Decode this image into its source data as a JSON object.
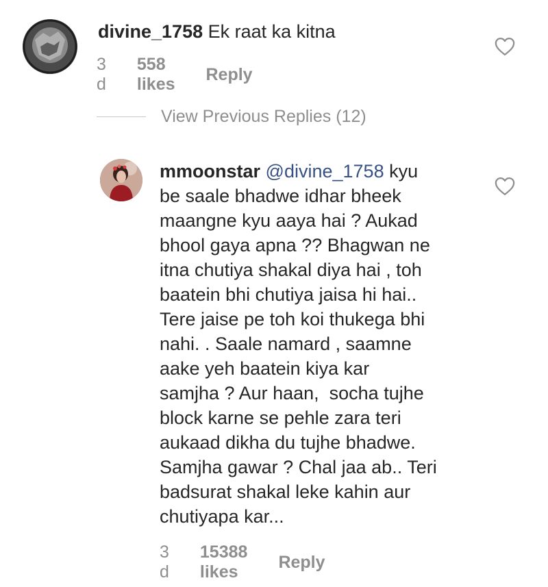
{
  "comment": {
    "username": "divine_1758",
    "text": " Ek raat ka kitna",
    "time": "3 d",
    "likes": "558 likes",
    "reply_label": "Reply",
    "avatar_icon": "avatar-icon",
    "like_icon": "heart-outline-icon"
  },
  "view_previous": {
    "label": "View Previous Replies (12)"
  },
  "reply": {
    "username": "mmoonstar",
    "mention": "@divine_1758",
    "lines": [
      " kyu",
      "be saale bhadwe idhar bheek",
      "maangne kyu aaya hai ? Aukad",
      "bhool gaya apna ?? Bhagwan ne",
      "itna chutiya shakal diya hai , toh",
      "baatein bhi chutiya jaisa hi hai..",
      "Tere jaise pe toh koi thukega bhi",
      "nahi. . Saale namard , saamne",
      "aake yeh baatein kiya kar",
      "samjha ? Aur haan,  socha tujhe",
      "block karne se pehle zara teri",
      "aukaad dikha du tujhe bhadwe.",
      "Samjha gawar ? Chal jaa ab.. Teri",
      "badsurat shakal leke kahin aur",
      "chutiyapa kar..."
    ],
    "time": "3 d",
    "likes": "15388 likes",
    "reply_label": "Reply",
    "avatar_icon": "avatar-icon",
    "like_icon": "heart-outline-icon"
  },
  "colors": {
    "text": "#262626",
    "secondary": "#8e8e8e",
    "mention": "#385185",
    "divider": "#c7c7c7"
  }
}
